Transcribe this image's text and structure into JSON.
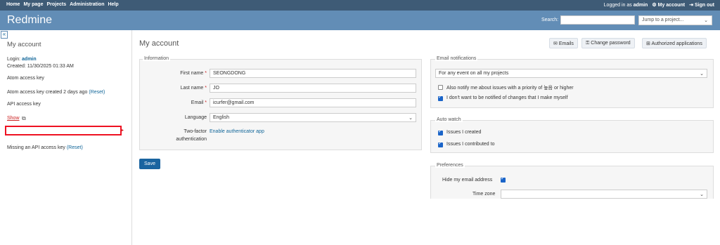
{
  "top_menu": {
    "items": [
      "Home",
      "My page",
      "Projects",
      "Administration",
      "Help"
    ],
    "logged_in_label": "Logged in as",
    "user": "admin",
    "my_account": "My account",
    "sign_out": "Sign out"
  },
  "header": {
    "title": "Redmine",
    "search_label": "Search:",
    "search_value": "",
    "jump_placeholder": "Jump to a project..."
  },
  "sidebar": {
    "collapse_glyph": "«",
    "title": "My account",
    "login_label": "Login:",
    "login_value": "admin",
    "created": "Created: 11/30/2025 01:33 AM",
    "atom_key_title": "Atom access key",
    "atom_key_created": "Atom access key created 2 days ago",
    "reset": "(Reset)",
    "api_key_title": "API access key",
    "show_link": "Show",
    "missing_api": "Missing an API access key",
    "reset2": "(Reset)"
  },
  "main": {
    "title": "My account",
    "actions": {
      "emails": "Emails",
      "change_password": "Change password",
      "authorized_apps": "Authorized applications"
    },
    "information": {
      "legend": "Information",
      "firstname_label": "First name",
      "firstname_value": "SEONGDONG",
      "lastname_label": "Last name",
      "lastname_value": "JO",
      "email_label": "Email",
      "email_value": "icurfer@gmail.com",
      "language_label": "Language",
      "language_value": "English",
      "twofa_label_1": "Two-factor",
      "twofa_label_2": "authentication",
      "twofa_link": "Enable authenticator app",
      "required_marker": "*"
    },
    "email_notifications": {
      "legend": "Email notifications",
      "option_selected": "For any event on all my projects",
      "notify_priority": "Also notify me about issues with a priority of 높음 or higher",
      "notify_priority_checked": false,
      "no_self_notified": "I don't want to be notified of changes that I make myself",
      "no_self_notified_checked": true
    },
    "auto_watch": {
      "legend": "Auto watch",
      "issues_created": "Issues I created",
      "issues_created_checked": true,
      "issues_contributed": "Issues I contributed to",
      "issues_contributed_checked": true
    },
    "preferences": {
      "legend": "Preferences",
      "hide_email_label": "Hide my email address",
      "hide_email_checked": true,
      "time_zone_label": "Time zone",
      "time_zone_value": ""
    },
    "save_label": "Save"
  },
  "colors": {
    "top_menu_bg": "#3e5b76",
    "header_bg": "#628db6",
    "link": "#169",
    "save_button": "#1a64a0",
    "highlight_box": "#e12"
  }
}
